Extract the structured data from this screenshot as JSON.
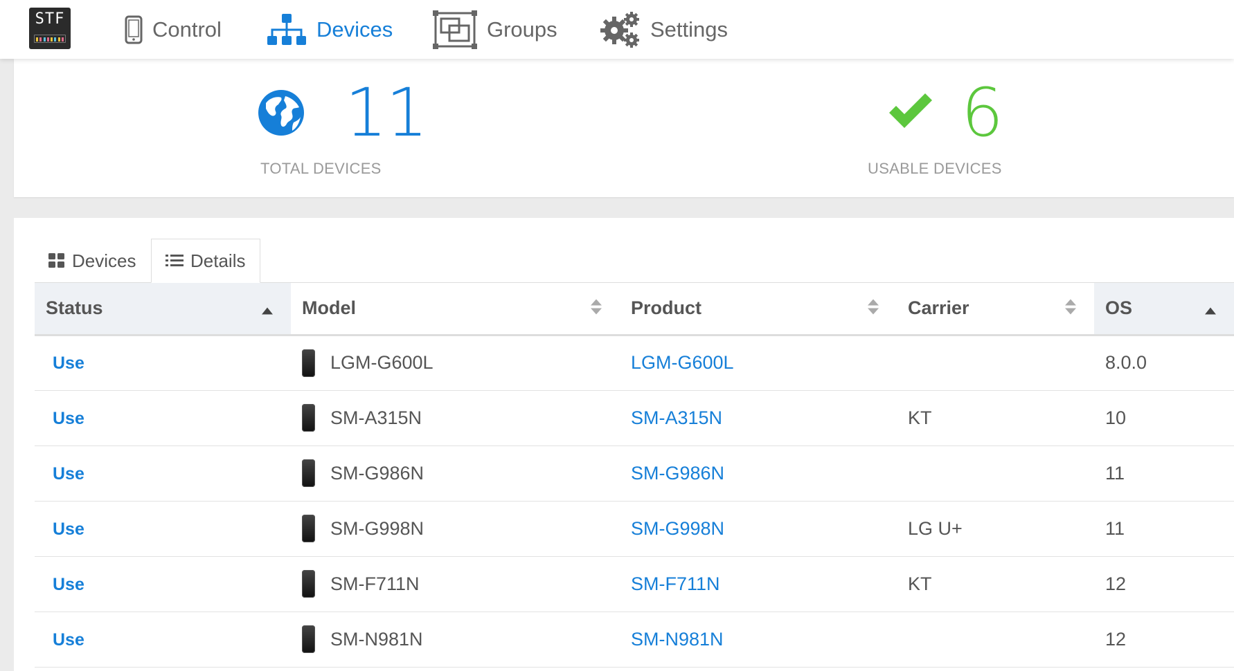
{
  "app": {
    "logo_text": "STF"
  },
  "nav": {
    "items": [
      {
        "label": "Control",
        "icon": "mobile-icon"
      },
      {
        "label": "Devices",
        "icon": "sitemap-icon",
        "active": true
      },
      {
        "label": "Groups",
        "icon": "object-group-icon"
      },
      {
        "label": "Settings",
        "icon": "gears-icon"
      }
    ]
  },
  "stats": {
    "total": {
      "value": "11",
      "label": "TOTAL DEVICES",
      "icon": "globe-icon",
      "color": "#167fd8"
    },
    "usable": {
      "value": "6",
      "label": "USABLE DEVICES",
      "icon": "check-icon",
      "color": "#5cc73d"
    }
  },
  "tabs": [
    {
      "label": "Devices",
      "icon": "grid-icon"
    },
    {
      "label": "Details",
      "icon": "list-icon",
      "active": true
    }
  ],
  "table": {
    "columns": [
      {
        "label": "Status",
        "sort": "asc"
      },
      {
        "label": "Model",
        "sort": "none"
      },
      {
        "label": "Product",
        "sort": "none"
      },
      {
        "label": "Carrier",
        "sort": "none"
      },
      {
        "label": "OS",
        "sort": "asc"
      }
    ],
    "rows": [
      {
        "status": "Use",
        "model": "LGM-G600L",
        "product": "LGM-G600L",
        "carrier": "",
        "os": "8.0.0"
      },
      {
        "status": "Use",
        "model": "SM-A315N",
        "product": "SM-A315N",
        "carrier": "KT",
        "os": "10"
      },
      {
        "status": "Use",
        "model": "SM-G986N",
        "product": "SM-G986N",
        "carrier": "",
        "os": "11"
      },
      {
        "status": "Use",
        "model": "SM-G998N",
        "product": "SM-G998N",
        "carrier": "LG U+",
        "os": "11"
      },
      {
        "status": "Use",
        "model": "SM-F711N",
        "product": "SM-F711N",
        "carrier": "KT",
        "os": "12"
      },
      {
        "status": "Use",
        "model": "SM-N981N",
        "product": "SM-N981N",
        "carrier": "",
        "os": "12"
      }
    ]
  },
  "colors": {
    "accent": "#167fd8",
    "usable": "#5cc73d",
    "header_sorted_bg": "#eef1f5"
  }
}
